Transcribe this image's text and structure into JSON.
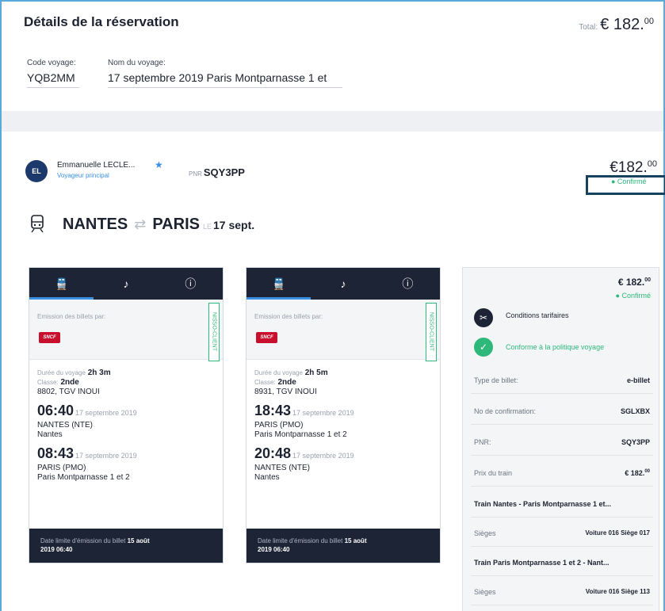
{
  "header": {
    "title": "Détails de la réservation",
    "total_label": "Total:",
    "total_main": "€ 182.",
    "total_cents": "00"
  },
  "trip": {
    "code_label": "Code voyage:",
    "code": "YQB2MM",
    "name_label": "Nom du voyage:",
    "name": "17 septembre 2019 Paris Montparnasse 1 et"
  },
  "traveler": {
    "initials": "EL",
    "name": "Emmanuelle LECLE...",
    "role": "Voyageur principal",
    "pnr_label": "PNR",
    "pnr": "SQY3PP",
    "price_main": "€182.",
    "price_cents": "00",
    "status": "● Confirmé"
  },
  "route": {
    "from": "NANTES",
    "arrow": "⇄",
    "to": "PARIS",
    "le": "LE",
    "date": "17 sept."
  },
  "cards": [
    {
      "issuer_label": "Emission des billets par:",
      "vertical_label": "NISSO-CLIENT",
      "sncf": "SNCF",
      "duration_label": "Durée du voyage",
      "duration": "2h 3m",
      "class_label": "Classe:",
      "class": "2nde",
      "train": "8802, TGV INOUI",
      "dep_time": "06:40",
      "dep_date": "17 septembre 2019",
      "dep_station": "NANTES (NTE)",
      "dep_city": "Nantes",
      "arr_time": "08:43",
      "arr_date": "17 septembre 2019",
      "arr_station": "PARIS (PMO)",
      "arr_city": "Paris Montparnasse 1 et 2",
      "foot_label": "Date limite d'émission du billet",
      "foot_value": "15 août",
      "foot_time": "2019 06:40"
    },
    {
      "issuer_label": "Emission des billets par:",
      "vertical_label": "NISSO-CLIENT",
      "sncf": "SNCF",
      "duration_label": "Durée du voyage",
      "duration": "2h 5m",
      "class_label": "Classe:",
      "class": "2nde",
      "train": "8931, TGV INOUI",
      "dep_time": "18:43",
      "dep_date": "17 septembre 2019",
      "dep_station": "PARIS (PMO)",
      "dep_city": "Paris Montparnasse 1 et 2",
      "arr_time": "20:48",
      "arr_date": "17 septembre 2019",
      "arr_station": "NANTES (NTE)",
      "arr_city": "Nantes",
      "foot_label": "Date limite d'émission du billet",
      "foot_value": "15 août",
      "foot_time": "2019 06:40"
    }
  ],
  "side": {
    "price": "€ 182.",
    "price_cents": "00",
    "status": "● Confirmé",
    "conditions": "Conditions tarifaires",
    "policy": "Conforme à la politique voyage",
    "rows": [
      {
        "k": "Type de billet:",
        "v": "e-billet"
      },
      {
        "k": "No de confirmation:",
        "v": "SGLXBX"
      },
      {
        "k": "PNR:",
        "v": "SQY3PP"
      },
      {
        "k": "Prix du train",
        "v": "€ 182.",
        "cents": "00"
      }
    ],
    "train1": "Train Nantes - Paris Montparnasse 1 et...",
    "seats1_label": "Sièges",
    "seats1_value": "Voiture 016 Siège 017",
    "train2": "Train Paris Montparnasse 1 et 2 - Nant...",
    "seats2_label": "Sièges",
    "seats2_value": "Voiture 016 Siège 113"
  }
}
